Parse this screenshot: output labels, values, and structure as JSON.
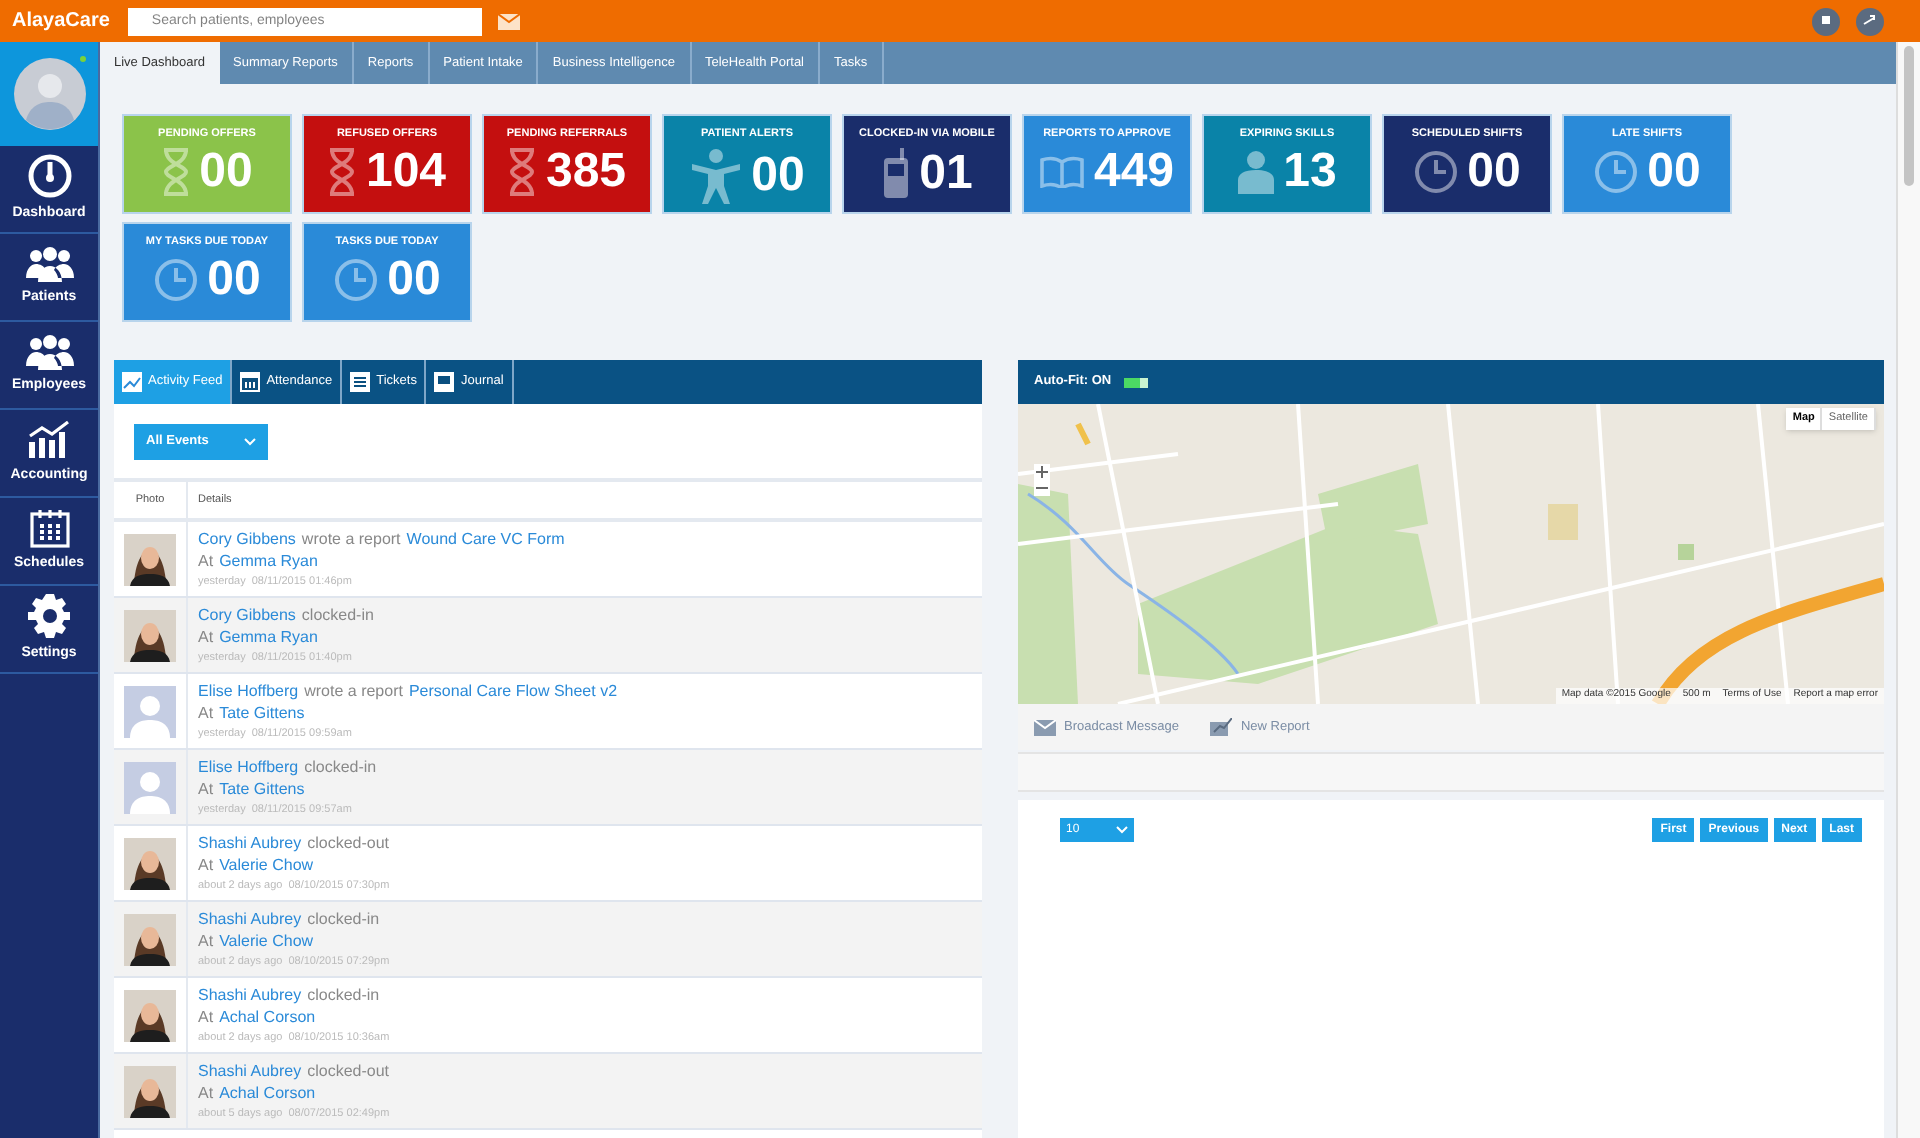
{
  "topbar": {
    "logo": "AlayaCare",
    "search": {
      "placeholder": "Search patients, employees"
    }
  },
  "sidebar": {
    "items": [
      {
        "label": "Dashboard",
        "kind": "dashboard"
      },
      {
        "label": "Patients",
        "kind": "people"
      },
      {
        "label": "Employees",
        "kind": "people"
      },
      {
        "label": "Accounting",
        "kind": "chart"
      },
      {
        "label": "Schedules",
        "kind": "calendar"
      },
      {
        "label": "Settings",
        "kind": "gear"
      }
    ]
  },
  "tabs": [
    {
      "label": "Live Dashboard",
      "selected": true
    },
    {
      "label": "Summary Reports",
      "selected": false
    },
    {
      "label": "Reports",
      "selected": false
    },
    {
      "label": "Patient Intake",
      "selected": false
    },
    {
      "label": "Business Intelligence",
      "selected": false
    },
    {
      "label": "TeleHealth Portal",
      "selected": false
    },
    {
      "label": "Tasks",
      "selected": false
    }
  ],
  "tiles": [
    {
      "title": "PENDING OFFERS",
      "value": "00",
      "kind": "hourglass",
      "color": "#8bc34a"
    },
    {
      "title": "REFUSED OFFERS",
      "value": "104",
      "kind": "hourglass",
      "color": "#c40f0f"
    },
    {
      "title": "PENDING REFERRALS",
      "value": "385",
      "kind": "hourglass",
      "color": "#c40f0f"
    },
    {
      "title": "PATIENT ALERTS",
      "value": "00",
      "kind": "person",
      "color": "#0a83a8"
    },
    {
      "title": "CLOCKED-IN VIA MOBILE",
      "value": "01",
      "kind": "phone",
      "color": "#1a2d6b"
    },
    {
      "title": "REPORTS TO APPROVE",
      "value": "449",
      "kind": "book",
      "color": "#2a8ad8"
    },
    {
      "title": "EXPIRING SKILLS",
      "value": "13",
      "kind": "bust",
      "color": "#0a83a8"
    },
    {
      "title": "SCHEDULED SHIFTS",
      "value": "00",
      "kind": "clock",
      "color": "#1a2d6b"
    },
    {
      "title": "LATE SHIFTS",
      "value": "00",
      "kind": "clock",
      "color": "#2a8ad8"
    },
    {
      "title": "MY TASKS DUE TODAY",
      "value": "00",
      "kind": "clock",
      "color": "#2a8ad8"
    },
    {
      "title": "TASKS DUE TODAY",
      "value": "00",
      "kind": "clock",
      "color": "#2a8ad8"
    }
  ],
  "feed": {
    "tabs": [
      {
        "label": "Activity Feed",
        "selected": true,
        "kind": "chart"
      },
      {
        "label": "Attendance",
        "selected": false,
        "kind": "calendar"
      },
      {
        "label": "Tickets",
        "selected": false,
        "kind": "list"
      },
      {
        "label": "Journal",
        "selected": false,
        "kind": "book"
      }
    ],
    "filter": "All Events",
    "columns": [
      "Photo",
      "Details"
    ],
    "rows": [
      {
        "kind": "picture",
        "actor": "Cory Gibbens",
        "action": "wrote a report",
        "report": "Wound Care VC Form",
        "at": "At",
        "client": "Gemma Ryan",
        "when": "yesterday",
        "time": "08/11/2015 01:46pm"
      },
      {
        "kind": "picture",
        "actor": "Cory Gibbens",
        "action": "clocked-in",
        "at": "At",
        "client": "Gemma Ryan",
        "when": "yesterday",
        "time": "08/11/2015 01:40pm"
      },
      {
        "kind": "placeholder",
        "actor": "Elise Hoffberg",
        "action": "wrote a report",
        "report": "Personal Care Flow Sheet v2",
        "at": "At",
        "client": "Tate Gittens",
        "when": "yesterday",
        "time": "08/11/2015 09:59am"
      },
      {
        "kind": "placeholder",
        "actor": "Elise Hoffberg",
        "action": "clocked-in",
        "at": "At",
        "client": "Tate Gittens",
        "when": "yesterday",
        "time": "08/11/2015 09:57am"
      },
      {
        "kind": "picture",
        "actor": "Shashi Aubrey",
        "action": "clocked-out",
        "at": "At",
        "client": "Valerie Chow",
        "when": "about 2 days ago",
        "time": "08/10/2015 07:30pm"
      },
      {
        "kind": "picture",
        "actor": "Shashi Aubrey",
        "action": "clocked-in",
        "at": "At",
        "client": "Valerie Chow",
        "when": "about 2 days ago",
        "time": "08/10/2015 07:29pm"
      },
      {
        "kind": "picture",
        "actor": "Shashi Aubrey",
        "action": "clocked-in",
        "at": "At",
        "client": "Achal Corson",
        "when": "about 2 days ago",
        "time": "08/10/2015 10:36am"
      },
      {
        "kind": "picture",
        "actor": "Shashi Aubrey",
        "action": "clocked-out",
        "at": "At",
        "client": "Achal Corson",
        "when": "about 5 days ago",
        "time": "08/07/2015 02:49pm"
      }
    ]
  },
  "map_panel": {
    "autofit": {
      "label": "Auto-Fit: ON",
      "on": true
    },
    "map_types": [
      {
        "label": "Map",
        "selected": true
      },
      {
        "label": "Satellite",
        "selected": false
      }
    ],
    "attribution": [
      "Map data ©2015 Google",
      "500 m",
      "Terms of Use",
      "Report a map error"
    ],
    "actions": [
      {
        "label": "Broadcast Message",
        "kind": "mail"
      },
      {
        "label": "New Report",
        "kind": "report"
      }
    ],
    "page_size": "10",
    "pager": [
      "First",
      "Previous",
      "Next",
      "Last"
    ]
  }
}
